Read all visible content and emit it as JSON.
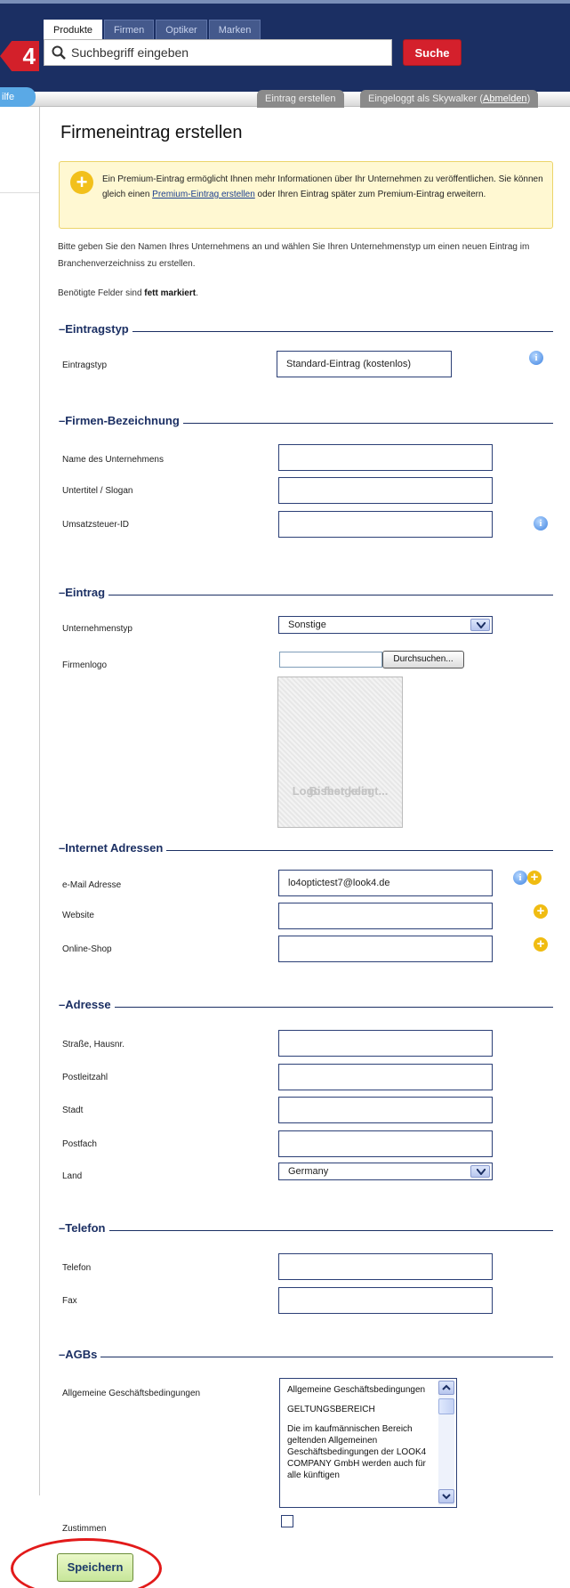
{
  "header": {
    "logo": "4",
    "tabs": [
      "Produkte",
      "Firmen",
      "Optiker",
      "Marken"
    ],
    "search_placeholder": "Suchbegriff eingeben",
    "search_button": "Suche",
    "hilfe": "ilfe",
    "create_entry_tab": "Eintrag erstellen",
    "logged_in_prefix": "Eingeloggt als Skywalker (",
    "logout_link": "Abmelden",
    "logged_in_suffix": ")"
  },
  "page": {
    "title": "Firmeneintrag erstellen",
    "notice": {
      "text1": "Ein Premium-Eintrag ermöglicht Ihnen mehr Informationen über Ihr Unternehmen zu veröffentlichen. Sie können gleich einen ",
      "link": "Premium-Eintrag erstellen",
      "text2": " oder Ihren Eintrag später zum Premium-Eintrag erweitern."
    },
    "intro": "Bitte geben Sie den Namen Ihres Unternehmens an und wählen Sie Ihren Unternehmenstyp um einen neuen Eintrag im Branchenverzeichniss zu erstellen.",
    "required_prefix": "Benötigte Felder sind ",
    "required_bold": "fett markiert",
    "required_suffix": "."
  },
  "sections": {
    "eintragstyp": "Eintragstyp",
    "firmen": "Firmen-Bezeichnung",
    "eintrag": "Eintrag",
    "internet": "Internet Adressen",
    "adresse": "Adresse",
    "telefon": "Telefon",
    "agbs": "AGBs"
  },
  "fields": {
    "eintragstyp": {
      "label": "Eintragstyp",
      "value": "Standard-Eintrag (kostenlos)"
    },
    "name": {
      "label": "Name des Unternehmens",
      "value": ""
    },
    "untertitel": {
      "label": "Untertitel / Slogan",
      "value": ""
    },
    "ust": {
      "label": "Umsatzsteuer-ID",
      "value": ""
    },
    "unternehmenstyp": {
      "label": "Unternehmenstyp",
      "value": "Sonstige"
    },
    "firmenlogo": {
      "label": "Firmenlogo",
      "browse": "Durchsuchen...",
      "placeholder_line1": "Bisher kein",
      "placeholder_line2": "Logo festgelegt..."
    },
    "email": {
      "label": "e-Mail Adresse",
      "value": "lo4optictest7@look4.de"
    },
    "website": {
      "label": "Website",
      "value": ""
    },
    "shop": {
      "label": "Online-Shop",
      "value": ""
    },
    "strasse": {
      "label": "Straße, Hausnr.",
      "value": ""
    },
    "plz": {
      "label": "Postleitzahl",
      "value": ""
    },
    "stadt": {
      "label": "Stadt",
      "value": ""
    },
    "postfach": {
      "label": "Postfach",
      "value": ""
    },
    "land": {
      "label": "Land",
      "value": "Germany"
    },
    "telefon": {
      "label": "Telefon",
      "value": ""
    },
    "fax": {
      "label": "Fax",
      "value": ""
    },
    "agb": {
      "label": "Allgemeine Geschäftsbedingungen",
      "p1": "Allgemeine Geschäftsbedingungen",
      "p2": "GELTUNGSBEREICH",
      "p3": "Die im kaufmännischen Bereich geltenden Allgemeinen Geschäftsbedingungen der LOOK4 COMPANY GmbH werden auch für alle künftigen"
    },
    "zustimmen": {
      "label": "Zustimmen"
    }
  },
  "save_button": "Speichern",
  "colors": {
    "brand_red": "#d4202c",
    "navy": "#1b2f63",
    "info_blue": "#3d82e0",
    "add_yellow": "#f0bc12",
    "annotation_red": "#e21a1a"
  }
}
